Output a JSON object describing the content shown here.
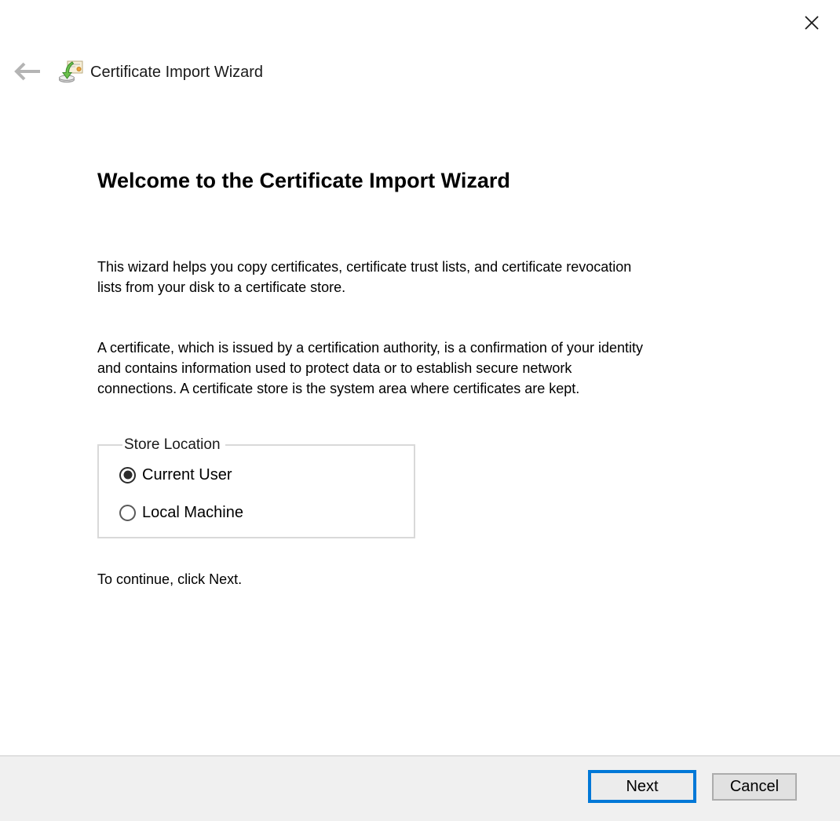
{
  "window": {
    "icons": {
      "close": "close-icon",
      "back": "back-arrow-icon",
      "app": "certificate-import-wizard-icon"
    }
  },
  "header": {
    "title": "Certificate Import Wizard"
  },
  "main": {
    "heading": "Welcome to the Certificate Import Wizard",
    "paragraphs": [
      {
        "lines": [
          "This wizard helps you copy certificates, certificate trust lists, and certificate revocation",
          "lists from your disk to a certificate store."
        ]
      },
      {
        "lines": [
          "A certificate, which is issued by a certification authority, is a confirmation of your identity",
          "and contains information used to protect data or to establish secure network",
          "connections. A certificate store is the system area where certificates are kept."
        ]
      }
    ],
    "store_location": {
      "label": "Store Location",
      "options": [
        {
          "label": "Current User",
          "selected": true
        },
        {
          "label": "Local Machine",
          "selected": false
        }
      ]
    },
    "hint": "To continue, click Next."
  },
  "buttons": {
    "next": "Next",
    "cancel": "Cancel"
  },
  "colors": {
    "accent": "#0078d7",
    "footer_bg": "#f0f0f0",
    "footer_divider": "#dfdfdf",
    "button_bg": "#e1e1e1",
    "button_border": "#acacac",
    "groupbox_border": "#d9d9d9",
    "back_arrow": "#b4b4b4",
    "text": "#000000"
  }
}
